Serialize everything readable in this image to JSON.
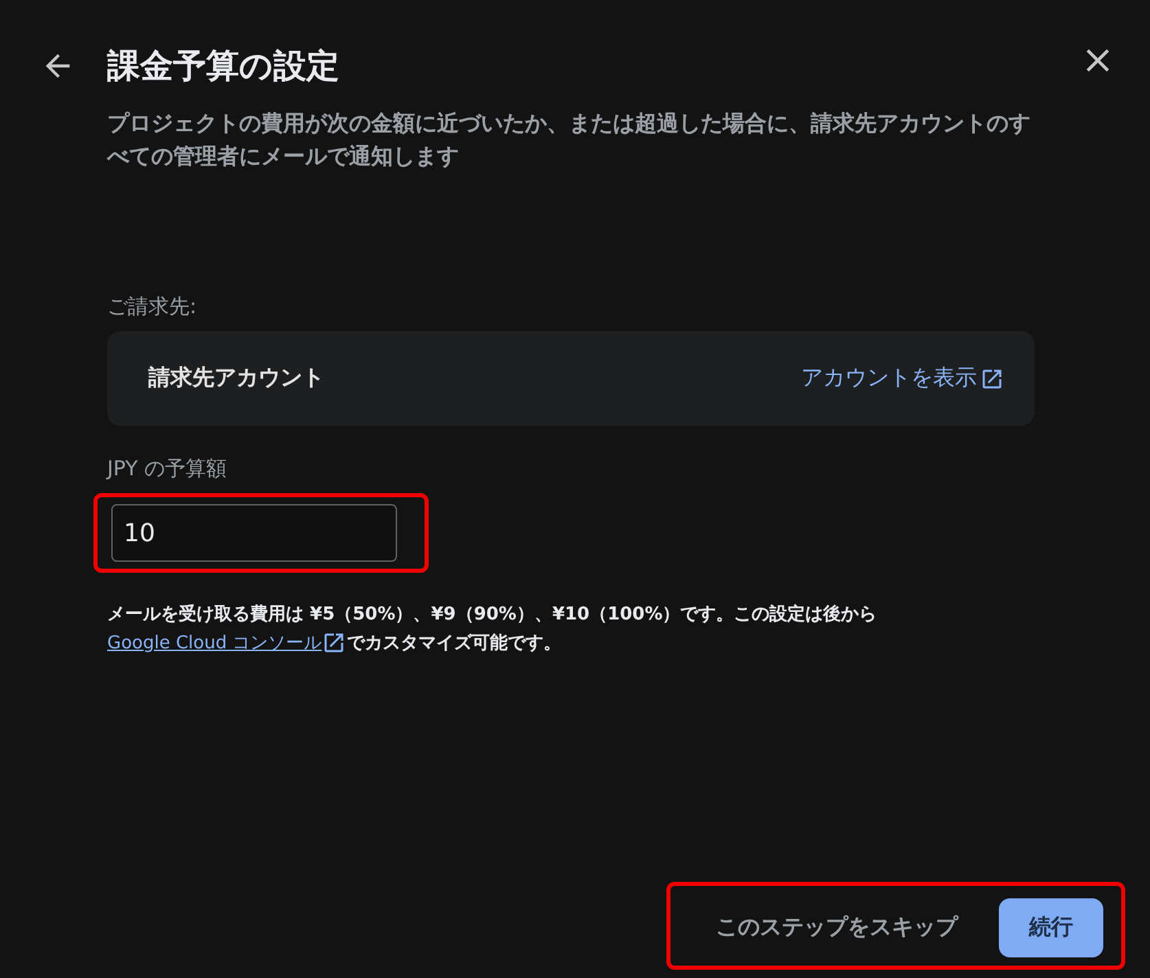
{
  "dialog": {
    "title": "課金予算の設定",
    "description": "プロジェクトの費用が次の金額に近づいたか、または超過した場合に、請求先アカウントのすべての管理者にメールで通知します"
  },
  "billing": {
    "label": "ご請求先:",
    "account": "請求先アカウント",
    "link": "アカウントを表示"
  },
  "budget": {
    "label": "JPY の予算額",
    "value": "10",
    "highlighted": true
  },
  "help": {
    "text_before": "メールを受け取る費用は ¥5（50%）、¥9（90%）、¥10（100%）です。この設定は後から",
    "link": "Google Cloud コンソール",
    "text_after": "でカスタマイズ可能です。"
  },
  "footer": {
    "highlighted": true,
    "buttons": [
      {
        "label": "このステップをスキップ",
        "kind": "text"
      },
      {
        "label": "続行",
        "kind": "filled"
      }
    ]
  }
}
